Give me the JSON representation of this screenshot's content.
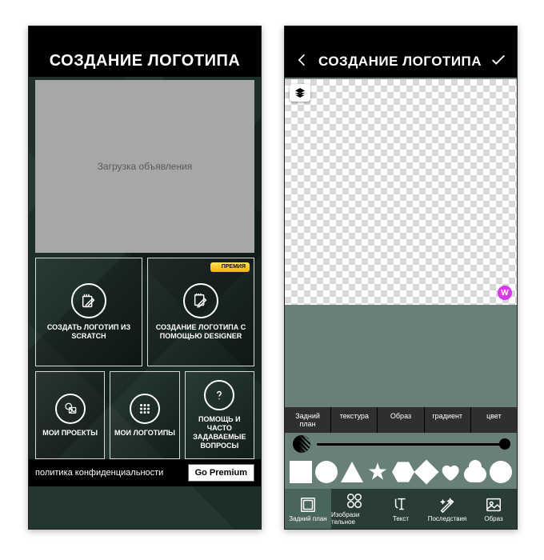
{
  "left": {
    "title": "СОЗДАНИЕ ЛОГОТИПА",
    "ad_text": "Загрузка объявления",
    "premium_badge": "⚡ПРЕМИЯ",
    "options": [
      {
        "label": "СОЗДАТЬ ЛОГОТИП ИЗ SCRATCH"
      },
      {
        "label": "СОЗДАНИЕ ЛОГОТИПА С ПОМОЩЬЮ DESIGNER"
      },
      {
        "label": "МОИ ПРОЕКТЫ"
      },
      {
        "label": "МОИ ЛОГОТИПЫ"
      },
      {
        "label": "ПОМОЩЬ И ЧАСТО ЗАДАВАЕМЫЕ ВОПРОСЫ"
      }
    ],
    "privacy": "политика конфиденциальности",
    "go_premium": "Go Premium"
  },
  "right": {
    "title": "СОЗДАНИЕ ЛОГОТИПА",
    "tabs": [
      "Задний план",
      "текстура",
      "Образ",
      "градиент",
      "цвет"
    ],
    "nav": [
      "Задний план",
      "Изобрази тельное",
      "Текст",
      "Последствия",
      "Образ"
    ]
  }
}
